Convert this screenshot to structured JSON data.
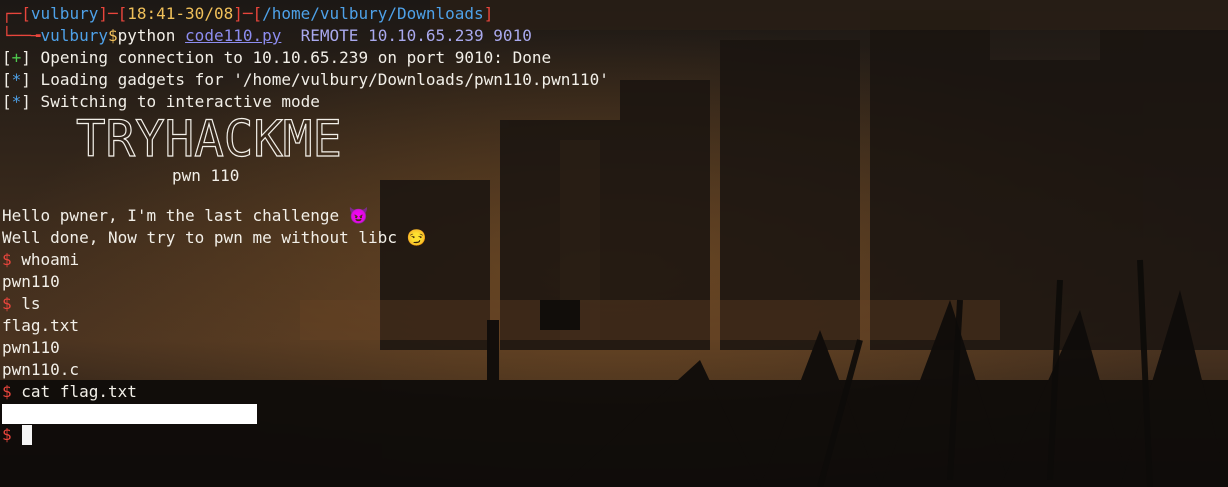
{
  "prompt": {
    "user": "vulbury",
    "time": "18:41-30/08",
    "cwd": "/home/vulbury/Downloads",
    "user2": "vulbury",
    "symbol": "$",
    "command": "python",
    "script": "code110.py",
    "args": "REMOTE 10.10.65.239 9010"
  },
  "output": [
    {
      "tag": "+",
      "text": " Opening connection to 10.10.65.239 on port 9010: Done"
    },
    {
      "tag": "*",
      "text": " Loading gadgets for '/home/vulbury/Downloads/pwn110.pwn110'"
    },
    {
      "tag": "*",
      "text": " Switching to interactive mode"
    }
  ],
  "banner": {
    "title": "TRYHACKME",
    "subtitle": "pwn 110"
  },
  "greeting": [
    "Hello pwner, I'm the last challenge 😈",
    "Well done, Now try to pwn me without libc 😏"
  ],
  "shell": {
    "prompt": "$",
    "cmd1": "whoami",
    "out1": "pwn110",
    "cmd2": "ls",
    "files": [
      "flag.txt",
      "pwn110",
      "pwn110.c"
    ],
    "cmd3": "cat flag.txt"
  },
  "colors": {
    "red": "#e8453c",
    "blue": "#4ea1e8",
    "yellow": "#f0c05a",
    "green": "#4ec94e"
  }
}
